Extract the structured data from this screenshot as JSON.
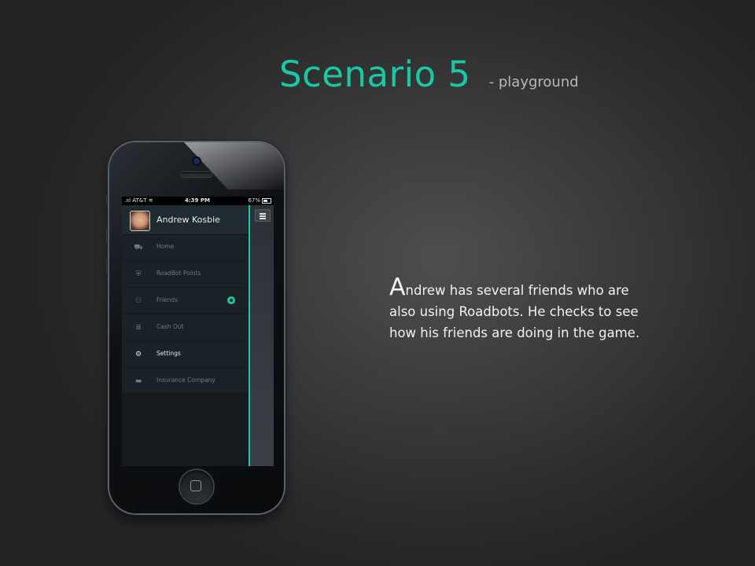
{
  "slide": {
    "title": "Scenario 5",
    "subtitle": "- playground",
    "description_first_letter": "A",
    "description_rest": "ndrew has several friends who are also using Roadbots. He checks to see how his friends are doing in the game."
  },
  "phone": {
    "status_bar": {
      "carrier": ".ııl AT&T ≋",
      "time": "4:39 PM",
      "battery": "67%"
    },
    "profile": {
      "name": "Andrew Kosbie"
    },
    "menu": [
      {
        "label": "Home",
        "icon": "car-icon",
        "glyph": "⛟"
      },
      {
        "label": "RoadBot Points",
        "icon": "shield-icon",
        "glyph": "⛨"
      },
      {
        "label": "Friends",
        "icon": "friends-icon",
        "glyph": "⚇"
      },
      {
        "label": "Cash Out",
        "icon": "coins-icon",
        "glyph": "≣"
      },
      {
        "label": "Settings",
        "icon": "gear-icon",
        "glyph": "⚙"
      },
      {
        "label": "Insurance Company",
        "icon": "card-icon",
        "glyph": "▬"
      }
    ],
    "active_item": "Settings",
    "badge_item": "Friends",
    "colors": {
      "accent": "#19c9a6",
      "menu_bg": "#1a2127"
    }
  }
}
